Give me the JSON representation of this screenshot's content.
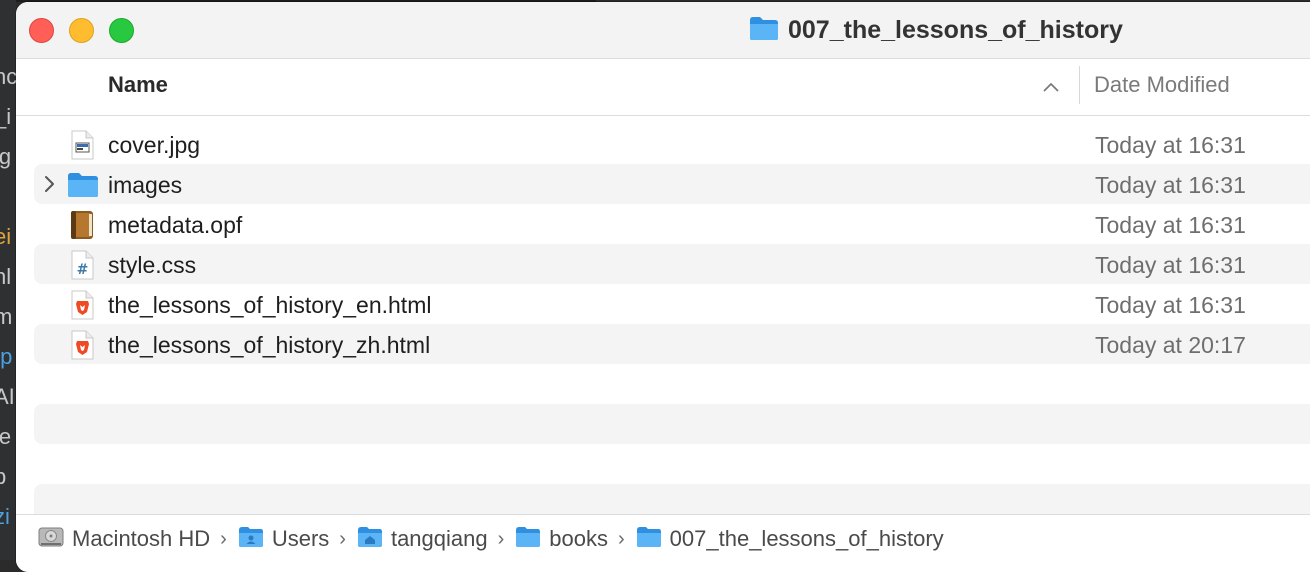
{
  "window": {
    "title": "007_the_lessons_of_history"
  },
  "columns": {
    "name": "Name",
    "date_modified": "Date Modified"
  },
  "files": [
    {
      "name": "cover.jpg",
      "date": "Today at 16:31",
      "icon": "jpg-file-icon"
    },
    {
      "name": "images",
      "date": "Today at 16:31",
      "icon": "folder-icon"
    },
    {
      "name": "metadata.opf",
      "date": "Today at 16:31",
      "icon": "ebook-file-icon"
    },
    {
      "name": "style.css",
      "date": "Today at 16:31",
      "icon": "css-file-icon"
    },
    {
      "name": "the_lessons_of_history_en.html",
      "date": "Today at 16:31",
      "icon": "brave-html-file-icon"
    },
    {
      "name": "the_lessons_of_history_zh.html",
      "date": "Today at 20:17",
      "icon": "brave-html-file-icon"
    }
  ],
  "pathbar": [
    {
      "label": "Macintosh HD",
      "icon": "hard-drive-icon"
    },
    {
      "label": "Users",
      "icon": "users-folder-icon"
    },
    {
      "label": "tangqiang",
      "icon": "home-folder-icon"
    },
    {
      "label": "books",
      "icon": "folder-icon"
    },
    {
      "label": "007_the_lessons_of_history",
      "icon": "folder-icon"
    }
  ],
  "colors": {
    "folder": "#41a7f0",
    "close": "#ff5f57",
    "minimize": "#febc2e",
    "zoom": "#28c840",
    "row_alt": "#f4f4f5"
  }
}
